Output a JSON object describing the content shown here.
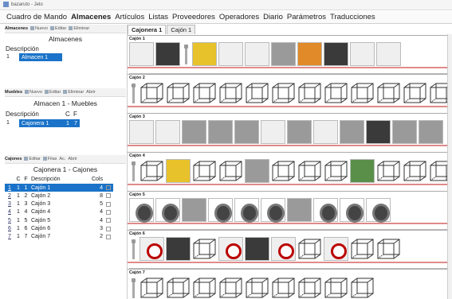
{
  "window": {
    "title": "bazaruto - Jelo"
  },
  "menu": [
    "Cuadro de Mando",
    "Almacenes",
    "Artículos",
    "Listas",
    "Proveedores",
    "Operadores",
    "Diario",
    "Parámetros",
    "Traducciones"
  ],
  "almacenes": {
    "toolbar_label": "Almacenes",
    "toolbar_items": [
      "Nuevo",
      "Editar",
      "Eliminar"
    ],
    "title": "Almacenes",
    "col_descripcion": "Descripción",
    "row_num": "1",
    "row_value": "Almacen 1"
  },
  "muebles": {
    "toolbar_label": "Muebles",
    "toolbar_items": [
      "Nuevo",
      "Editar",
      "Eliminar",
      "Abrir"
    ],
    "title": "Almacen 1 - Muebles",
    "col_descripcion": "Descripción",
    "col_c": "C",
    "col_f": "F",
    "row_num": "1",
    "row_value": "Cajonera 1",
    "row_c": "1",
    "row_f": "7"
  },
  "cajones": {
    "toolbar_label": "Cajones",
    "toolbar_items": [
      "Editar",
      "Filas",
      "Ac.",
      "Abrir"
    ],
    "title": "Cajonera 1 - Cajones",
    "col_c": "C",
    "col_f": "F",
    "col_descripcion": "Descripción",
    "col_cols": "Cols",
    "rows": [
      {
        "n": "1",
        "c": "1",
        "f": "1",
        "d": "Cajón 1",
        "cols": "4"
      },
      {
        "n": "2",
        "c": "1",
        "f": "2",
        "d": "Cajón 2",
        "cols": "8"
      },
      {
        "n": "3",
        "c": "1",
        "f": "3",
        "d": "Cajón 3",
        "cols": "5"
      },
      {
        "n": "4",
        "c": "1",
        "f": "4",
        "d": "Cajón 4",
        "cols": "4"
      },
      {
        "n": "5",
        "c": "1",
        "f": "5",
        "d": "Cajón 5",
        "cols": "4"
      },
      {
        "n": "6",
        "c": "1",
        "f": "6",
        "d": "Cajón 6",
        "cols": "3"
      },
      {
        "n": "7",
        "c": "1",
        "f": "7",
        "d": "Cajón 7",
        "cols": "2"
      }
    ]
  },
  "tabs": [
    "Cajonera 1",
    "Cajón 1"
  ],
  "strips": [
    {
      "label": "Cajón 1",
      "cells": [
        "pic:red",
        "pic:white",
        "pic:dark",
        "bolt",
        "pic:yellow",
        "pic:white",
        "pic:white",
        "pic:grey",
        "pic:orange",
        "pic:dark",
        "pic:white",
        "pic:white"
      ]
    },
    {
      "label": "Cajón 2",
      "cells": [
        "bolt",
        "box",
        "box",
        "box",
        "box",
        "box",
        "box",
        "box",
        "box",
        "box",
        "box",
        "box",
        "box"
      ]
    },
    {
      "label": "Cajón 3",
      "cells": [
        "pic:white",
        "pic:white",
        "pic:grey",
        "pic:grey",
        "pic:grey",
        "pic:white",
        "pic:grey",
        "pic:white",
        "pic:grey",
        "pic:dark",
        "pic:grey",
        "pic:grey"
      ]
    },
    {
      "label": "Cajón 4",
      "cells": [
        "bolt",
        "box",
        "pic:yellow",
        "box",
        "box",
        "pic:grey",
        "box",
        "box",
        "box",
        "pic:green",
        "box",
        "box",
        "box"
      ]
    },
    {
      "label": "Cajón 5",
      "cells": [
        "wheel",
        "wheel",
        "pic:grey",
        "wheel",
        "wheel",
        "wheel",
        "pic:red",
        "pic:grey",
        "wheel",
        "pic:red",
        "wheel",
        "wheel"
      ]
    },
    {
      "label": "Cajón 6",
      "cells": [
        "bolt",
        "dot",
        "pic:red",
        "pic:dark",
        "box",
        "dot",
        "pic:dark",
        "dot",
        "box",
        "dot",
        "box",
        "box"
      ]
    },
    {
      "label": "Cajón 7",
      "cells": [
        "bolt",
        "box",
        "box",
        "box",
        "box",
        "box",
        "box",
        "box",
        "box",
        "box"
      ]
    }
  ]
}
